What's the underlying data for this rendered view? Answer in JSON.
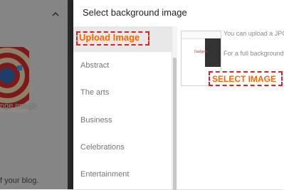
{
  "background_page": {
    "thumb_caption": "nge image",
    "footer_text": "f your blog."
  },
  "dialog": {
    "title": "Select background image",
    "categories": [
      {
        "label": "Upload Image",
        "active": true
      },
      {
        "label": "Abstract"
      },
      {
        "label": "The arts"
      },
      {
        "label": "Business"
      },
      {
        "label": "Celebrations"
      },
      {
        "label": "Entertainment"
      }
    ],
    "info_text_1": "You can upload a JPG, G",
    "info_text_2": "For a full background, u",
    "preview_label": "Gadgets",
    "select_button_label": "SELECT IMAGE"
  },
  "colors": {
    "highlight_orange": "#ff6600",
    "dashed_red": "#dd2222"
  }
}
